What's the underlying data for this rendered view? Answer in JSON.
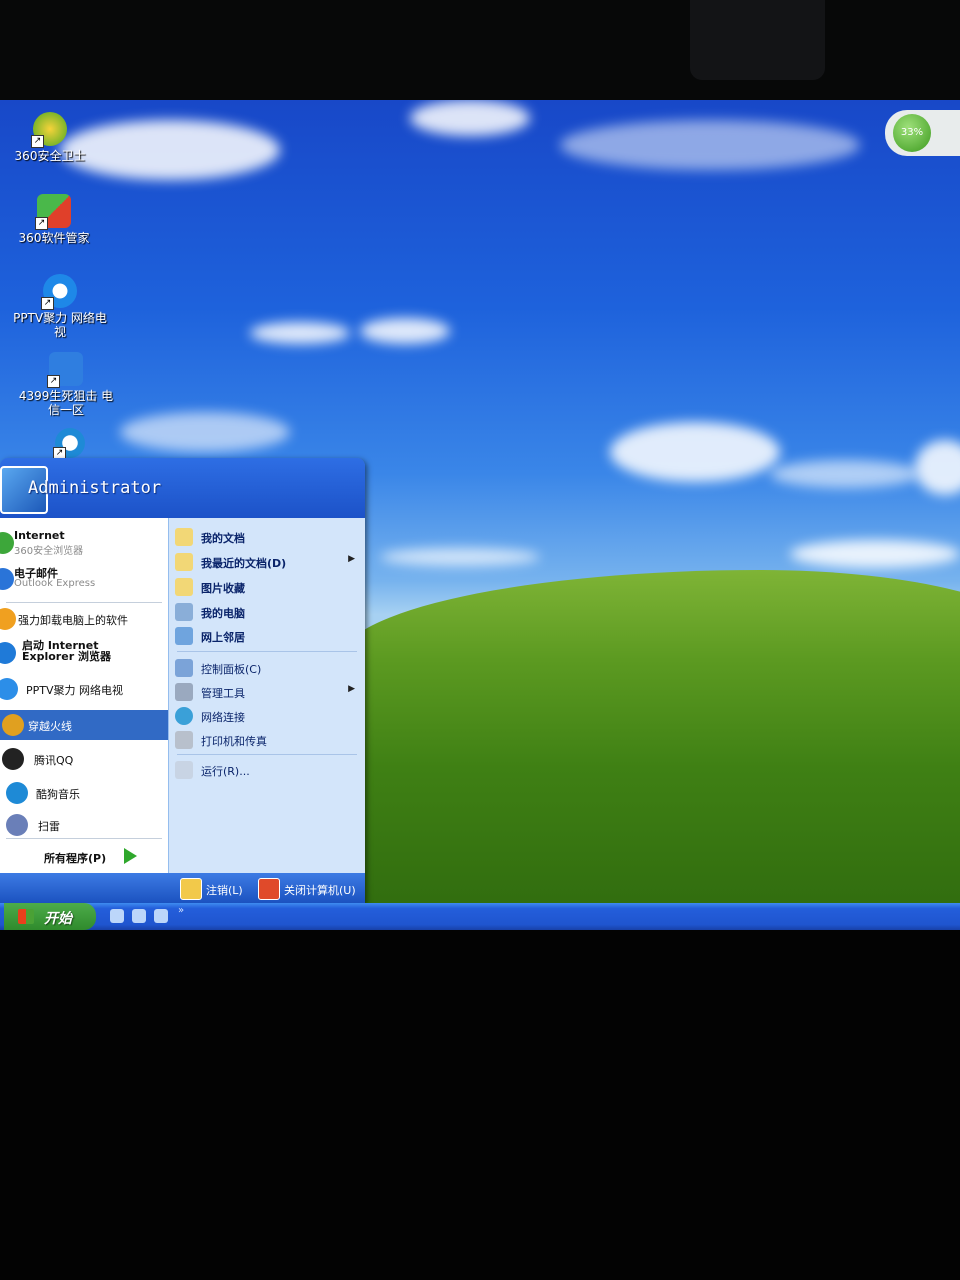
{
  "desktop": {
    "icons": [
      {
        "label": "360安全卫士"
      },
      {
        "label": "360软件管家"
      },
      {
        "label": "PPTV聚力 网络电视"
      },
      {
        "label": "4399生死狙击 电信一区"
      },
      {
        "label": ""
      }
    ],
    "tray_widget_text": "33%"
  },
  "start_menu": {
    "user_name": "Administrator",
    "pinned": [
      {
        "title": "Internet",
        "subtitle": "360安全浏览器"
      },
      {
        "title": "电子邮件",
        "subtitle": "Outlook Express"
      }
    ],
    "recent": [
      {
        "label": "强力卸载电脑上的软件"
      },
      {
        "label": "启动 Internet Explorer 浏览器"
      },
      {
        "label": "PPTV聚力 网络电视"
      },
      {
        "label": "穿越火线"
      },
      {
        "label": "腾讯QQ"
      },
      {
        "label": "酷狗音乐"
      },
      {
        "label": "扫雷"
      }
    ],
    "all_programs": "所有程序(P)",
    "right": [
      {
        "label": "我的文档",
        "bold": true
      },
      {
        "label": "我最近的文档(D)",
        "bold": true
      },
      {
        "label": "图片收藏",
        "bold": true
      },
      {
        "label": "我的电脑",
        "bold": true
      },
      {
        "label": "网上邻居",
        "bold": true
      },
      {
        "label": "控制面板(C)"
      },
      {
        "label": "管理工具"
      },
      {
        "label": "网络连接"
      },
      {
        "label": "打印机和传真"
      },
      {
        "label": "运行(R)..."
      }
    ],
    "logoff": "注销(L)",
    "shutdown": "关闭计算机(U)"
  },
  "taskbar": {
    "start_label": "开始"
  },
  "colors": {
    "sky": "#1e62dc",
    "hill": "#4f8e1a",
    "start_menu_header": "#2e6ee4",
    "selection": "#316ac5",
    "start_button": "#3a9b37"
  }
}
